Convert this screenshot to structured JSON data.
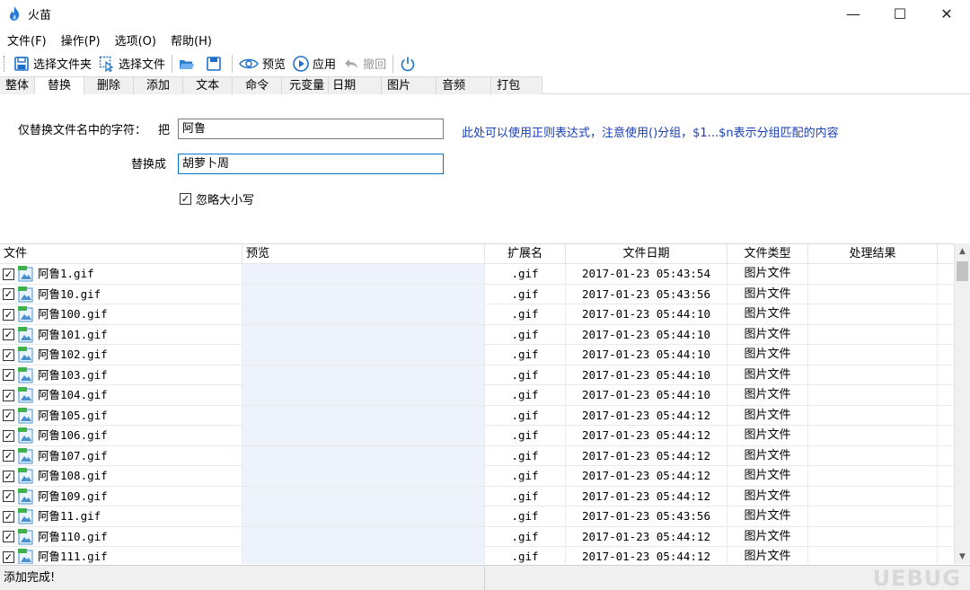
{
  "window": {
    "title": "火苗",
    "minimize": "—",
    "maximize": "☐",
    "close": "✕"
  },
  "menu": [
    "文件(F)",
    "操作(P)",
    "选项(O)",
    "帮助(H)"
  ],
  "toolbar": {
    "select_folder": "选择文件夹",
    "select_file": "选择文件",
    "preview": "预览",
    "apply": "应用",
    "undo": "撤回"
  },
  "tabs": [
    "整体",
    "替换",
    "删除",
    "添加",
    "文本",
    "命令",
    "元变量",
    "日期",
    "图片",
    "音频",
    "打包"
  ],
  "active_tab": "替换",
  "form": {
    "replace_label": "仅替换文件名中的字符：",
    "from_label": "把",
    "from_value": "阿鲁",
    "to_label": "替换成",
    "to_value": "胡萝卜周",
    "hint": "此处可以使用正则表达式，注意使用()分组，$1...$n表示分组匹配的内容",
    "ignore_case_label": "忽略大小写",
    "ignore_case_checked": true
  },
  "table": {
    "headers": [
      "文件",
      "预览",
      "扩展名",
      "文件日期",
      "文件类型",
      "处理结果"
    ],
    "rows": [
      {
        "name": "阿鲁1.gif",
        "preview": "",
        "ext": ".gif",
        "date": "2017-01-23 05:43:54",
        "type": "图片文件",
        "result": ""
      },
      {
        "name": "阿鲁10.gif",
        "preview": "",
        "ext": ".gif",
        "date": "2017-01-23 05:43:56",
        "type": "图片文件",
        "result": ""
      },
      {
        "name": "阿鲁100.gif",
        "preview": "",
        "ext": ".gif",
        "date": "2017-01-23 05:44:10",
        "type": "图片文件",
        "result": ""
      },
      {
        "name": "阿鲁101.gif",
        "preview": "",
        "ext": ".gif",
        "date": "2017-01-23 05:44:10",
        "type": "图片文件",
        "result": ""
      },
      {
        "name": "阿鲁102.gif",
        "preview": "",
        "ext": ".gif",
        "date": "2017-01-23 05:44:10",
        "type": "图片文件",
        "result": ""
      },
      {
        "name": "阿鲁103.gif",
        "preview": "",
        "ext": ".gif",
        "date": "2017-01-23 05:44:10",
        "type": "图片文件",
        "result": ""
      },
      {
        "name": "阿鲁104.gif",
        "preview": "",
        "ext": ".gif",
        "date": "2017-01-23 05:44:10",
        "type": "图片文件",
        "result": ""
      },
      {
        "name": "阿鲁105.gif",
        "preview": "",
        "ext": ".gif",
        "date": "2017-01-23 05:44:12",
        "type": "图片文件",
        "result": ""
      },
      {
        "name": "阿鲁106.gif",
        "preview": "",
        "ext": ".gif",
        "date": "2017-01-23 05:44:12",
        "type": "图片文件",
        "result": ""
      },
      {
        "name": "阿鲁107.gif",
        "preview": "",
        "ext": ".gif",
        "date": "2017-01-23 05:44:12",
        "type": "图片文件",
        "result": ""
      },
      {
        "name": "阿鲁108.gif",
        "preview": "",
        "ext": ".gif",
        "date": "2017-01-23 05:44:12",
        "type": "图片文件",
        "result": ""
      },
      {
        "name": "阿鲁109.gif",
        "preview": "",
        "ext": ".gif",
        "date": "2017-01-23 05:44:12",
        "type": "图片文件",
        "result": ""
      },
      {
        "name": "阿鲁11.gif",
        "preview": "",
        "ext": ".gif",
        "date": "2017-01-23 05:43:56",
        "type": "图片文件",
        "result": ""
      },
      {
        "name": "阿鲁110.gif",
        "preview": "",
        "ext": ".gif",
        "date": "2017-01-23 05:44:12",
        "type": "图片文件",
        "result": ""
      },
      {
        "name": "阿鲁111.gif",
        "preview": "",
        "ext": ".gif",
        "date": "2017-01-23 05:44:12",
        "type": "图片文件",
        "result": ""
      }
    ]
  },
  "status": {
    "text": "添加完成!",
    "watermark": "UEBUG"
  },
  "colors": {
    "hint": "#1a3fb5",
    "preview_column": "#eef3fb",
    "focus_border": "#0078d7",
    "accent_icon": "#1e6fc9"
  }
}
